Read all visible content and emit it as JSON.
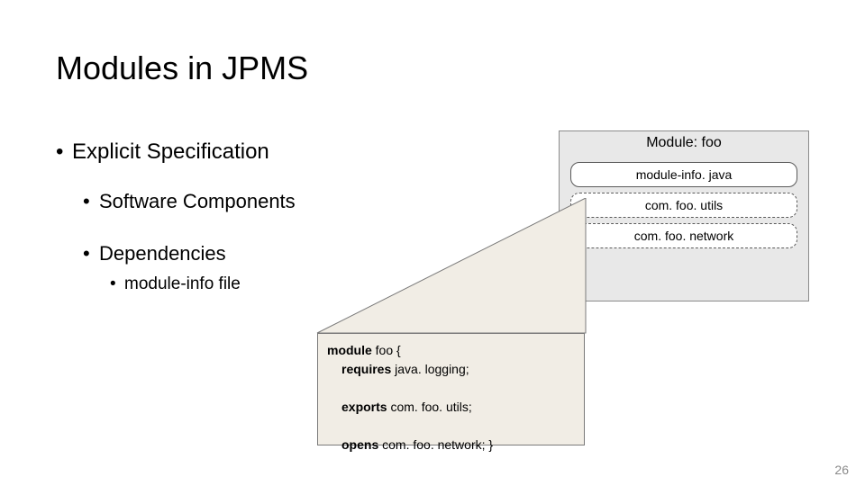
{
  "title": "Modules in JPMS",
  "bullets": {
    "l1": "Explicit Specification",
    "l2a": "Software Components",
    "l2b": "Dependencies",
    "l3": "module-info file"
  },
  "moduleBox": {
    "header": "Module: foo",
    "items": [
      "module-info. java",
      "com. foo. utils",
      "com. foo. network"
    ]
  },
  "code": {
    "kw_module": "module",
    "mod_name": "foo {",
    "kw_requires": "requires",
    "req_arg": "java. logging;",
    "kw_exports": "exports",
    "exp_arg": "com. foo. utils;",
    "kw_opens": "opens",
    "opens_arg": "com. foo. network; }"
  },
  "pageNumber": "26"
}
